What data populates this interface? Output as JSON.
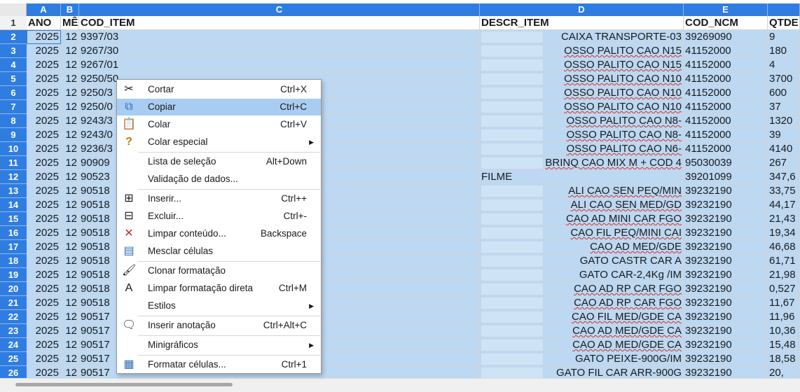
{
  "columns": [
    "A",
    "B",
    "C",
    "D",
    "E",
    ""
  ],
  "header_row": {
    "num": "1",
    "ano": "ANO",
    "mes": "MÊ",
    "cod_item": "COD_ITEM",
    "descr_item": "DESCR_ITEM",
    "cod_ncm": "COD_NCM",
    "qtd": "QTDE"
  },
  "rows": [
    {
      "num": "2",
      "ano": "2025",
      "mes": "12",
      "cod_item": "9397/03",
      "descr": "CAIXA TRANSPORTE-03",
      "ncm": "39269090",
      "qtd": "9"
    },
    {
      "num": "3",
      "ano": "2025",
      "mes": "12",
      "cod_item": "9267/30",
      "descr": "OSSO PALITO CAO N15",
      "ncm": "41152000",
      "qtd": "180"
    },
    {
      "num": "4",
      "ano": "2025",
      "mes": "12",
      "cod_item": "9267/01",
      "descr": "OSSO PALITO CAO N15",
      "ncm": "41152000",
      "qtd": "4"
    },
    {
      "num": "5",
      "ano": "2025",
      "mes": "12",
      "cod_item": "9250/50",
      "descr": "OSSO PALITO CAO N10",
      "ncm": "41152000",
      "qtd": "3700"
    },
    {
      "num": "6",
      "ano": "2025",
      "mes": "12",
      "cod_item": "9250/3",
      "descr": "OSSO PALITO CAO N10",
      "ncm": "41152000",
      "qtd": "600"
    },
    {
      "num": "7",
      "ano": "2025",
      "mes": "12",
      "cod_item": "9250/0",
      "descr": "OSSO PALITO CAO N10",
      "ncm": "41152000",
      "qtd": "37"
    },
    {
      "num": "8",
      "ano": "2025",
      "mes": "12",
      "cod_item": "9243/3",
      "descr": "OSSO PALITO CAO N8-",
      "ncm": "41152000",
      "qtd": "1320"
    },
    {
      "num": "9",
      "ano": "2025",
      "mes": "12",
      "cod_item": "9243/0",
      "descr": "OSSO PALITO CAO N8-",
      "ncm": "41152000",
      "qtd": "39"
    },
    {
      "num": "10",
      "ano": "2025",
      "mes": "12",
      "cod_item": "9236/3",
      "descr": "OSSO PALITO CAO N6-",
      "ncm": "41152000",
      "qtd": "4140"
    },
    {
      "num": "11",
      "ano": "2025",
      "mes": "12",
      "cod_item": "90909",
      "descr": "BRINQ CAO MIX M + COD 4",
      "ncm": "95030039",
      "qtd": "267"
    },
    {
      "num": "12",
      "ano": "2025",
      "mes": "12",
      "cod_item": "90523",
      "descr": "FILME",
      "ncm": "39201099",
      "qtd": "347,6"
    },
    {
      "num": "13",
      "ano": "2025",
      "mes": "12",
      "cod_item": "90518",
      "descr": "ALI CAO SEN PEQ/MIN",
      "ncm": "39232190",
      "qtd": "33,75"
    },
    {
      "num": "14",
      "ano": "2025",
      "mes": "12",
      "cod_item": "90518",
      "descr": "ALI CAO SEN MED/GD",
      "ncm": "39232190",
      "qtd": "44,17"
    },
    {
      "num": "15",
      "ano": "2025",
      "mes": "12",
      "cod_item": "90518",
      "descr": "CAO AD MINI CAR FGO",
      "ncm": "39232190",
      "qtd": "21,43"
    },
    {
      "num": "16",
      "ano": "2025",
      "mes": "12",
      "cod_item": "90518",
      "descr": "CAO FIL PEQ/MINI CAI",
      "ncm": "39232190",
      "qtd": "19,34"
    },
    {
      "num": "17",
      "ano": "2025",
      "mes": "12",
      "cod_item": "90518",
      "descr": "CAO AD MED/GDE",
      "ncm": "39232190",
      "qtd": "46,68"
    },
    {
      "num": "18",
      "ano": "2025",
      "mes": "12",
      "cod_item": "90518",
      "descr": "GATO CASTR CAR A",
      "ncm": "39232190",
      "qtd": "61,71"
    },
    {
      "num": "19",
      "ano": "2025",
      "mes": "12",
      "cod_item": "90518",
      "descr": "GATO CAR-2,4Kg /IM",
      "ncm": "39232190",
      "qtd": "21,98"
    },
    {
      "num": "20",
      "ano": "2025",
      "mes": "12",
      "cod_item": "90518",
      "descr": "CAO AD RP CAR FGO",
      "ncm": "39232190",
      "qtd": "0,527"
    },
    {
      "num": "21",
      "ano": "2025",
      "mes": "12",
      "cod_item": "90518",
      "descr": "CAO AD RP CAR FGO",
      "ncm": "39232190",
      "qtd": "11,67"
    },
    {
      "num": "22",
      "ano": "2025",
      "mes": "12",
      "cod_item": "90517",
      "descr": "CAO FIL MED/GDE CA",
      "ncm": "39232190",
      "qtd": "11,96"
    },
    {
      "num": "23",
      "ano": "2025",
      "mes": "12",
      "cod_item": "90517",
      "descr": "CAO AD MED/GDE CA",
      "ncm": "39232190",
      "qtd": "10,36"
    },
    {
      "num": "24",
      "ano": "2025",
      "mes": "12",
      "cod_item": "90517",
      "descr": "CAO AD MED/GDE CA",
      "ncm": "39232190",
      "qtd": "15,48"
    },
    {
      "num": "25",
      "ano": "2025",
      "mes": "12",
      "cod_item": "90517",
      "descr": "GATO PEIXE-900G/IM",
      "ncm": "39232190",
      "qtd": "18,58"
    },
    {
      "num": "26",
      "ano": "2025",
      "mes": "12",
      "cod_item": "90517",
      "descr": "GATO FIL CAR ARR-900G",
      "ncm": "39232190",
      "qtd": "20,"
    }
  ],
  "context_menu": [
    {
      "icon": "scissors-icon",
      "glyph": "✂",
      "label": "Cortar",
      "shortcut": "Ctrl+X"
    },
    {
      "icon": "copy-icon",
      "glyph": "⧉",
      "label": "Copiar",
      "shortcut": "Ctrl+C",
      "highlighted": true
    },
    {
      "icon": "paste-icon",
      "glyph": "📋",
      "label": "Colar",
      "shortcut": "Ctrl+V"
    },
    {
      "icon": "paste-special-icon",
      "glyph": "?",
      "label": "Colar especial",
      "shortcut": "",
      "submenu": true
    },
    {
      "separator": true
    },
    {
      "icon": "",
      "glyph": "",
      "label": "Lista de seleção",
      "shortcut": "Alt+Down"
    },
    {
      "icon": "",
      "glyph": "",
      "label": "Validação de dados...",
      "shortcut": ""
    },
    {
      "separator": true
    },
    {
      "icon": "insert-cells-icon",
      "glyph": "⊞",
      "label": "Inserir...",
      "shortcut": "Ctrl++"
    },
    {
      "icon": "delete-cells-icon",
      "glyph": "⊟",
      "label": "Excluir...",
      "shortcut": "Ctrl+-"
    },
    {
      "icon": "clear-contents-icon",
      "glyph": "✕",
      "label": "Limpar conteúdo...",
      "shortcut": "Backspace"
    },
    {
      "icon": "merge-cells-icon",
      "glyph": "▤",
      "label": "Mesclar células",
      "shortcut": ""
    },
    {
      "separator": true
    },
    {
      "icon": "clone-formatting-icon",
      "glyph": "🖌",
      "label": "Clonar formatação",
      "shortcut": ""
    },
    {
      "icon": "clear-direct-formatting-icon",
      "glyph": "A",
      "label": "Limpar formatação direta",
      "shortcut": "Ctrl+M"
    },
    {
      "icon": "",
      "glyph": "",
      "label": "Estilos",
      "shortcut": "",
      "submenu": true
    },
    {
      "separator": true
    },
    {
      "icon": "comment-icon",
      "glyph": "🗨",
      "label": "Inserir anotação",
      "shortcut": "Ctrl+Alt+C"
    },
    {
      "separator": true
    },
    {
      "icon": "",
      "glyph": "",
      "label": "Minigráficos",
      "shortcut": "",
      "submenu": true
    },
    {
      "separator": true
    },
    {
      "icon": "format-cells-icon",
      "glyph": "▦",
      "label": "Formatar células...",
      "shortcut": "Ctrl+1"
    }
  ],
  "colors": {
    "selection": "#bcd8f2",
    "header_active": "#2f7de1",
    "menu_highlight": "#a9cdf2"
  }
}
